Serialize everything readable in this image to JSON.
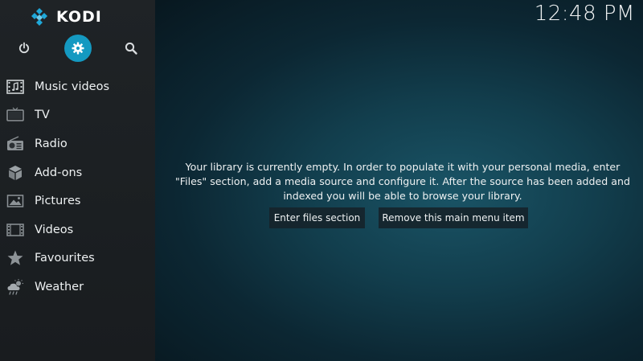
{
  "app": {
    "name": "KODI",
    "clock": "12:48 PM"
  },
  "top_icons": [
    {
      "icon": "power-icon"
    },
    {
      "icon": "gear-icon",
      "active": true
    },
    {
      "icon": "search-icon"
    }
  ],
  "menu": {
    "items": [
      {
        "label": "Music videos",
        "icon": "music-video-icon"
      },
      {
        "label": "TV",
        "icon": "tv-icon"
      },
      {
        "label": "Radio",
        "icon": "radio-icon"
      },
      {
        "label": "Add-ons",
        "icon": "addons-icon"
      },
      {
        "label": "Pictures",
        "icon": "pictures-icon"
      },
      {
        "label": "Videos",
        "icon": "film-icon"
      },
      {
        "label": "Favourites",
        "icon": "star-icon"
      },
      {
        "label": "Weather",
        "icon": "weather-icon"
      }
    ]
  },
  "main": {
    "message": "Your library is currently empty. In order to populate it with your personal media, enter\n\"Files\" section, add a media source and configure it. After the source has been added and\nindexed you will be able to browse your library.",
    "enter_files_label": "Enter files section",
    "remove_item_label": "Remove this main menu item"
  },
  "colors": {
    "accent": "#1499c1",
    "sidebar": "#1d2124",
    "background": "#123e4d"
  }
}
